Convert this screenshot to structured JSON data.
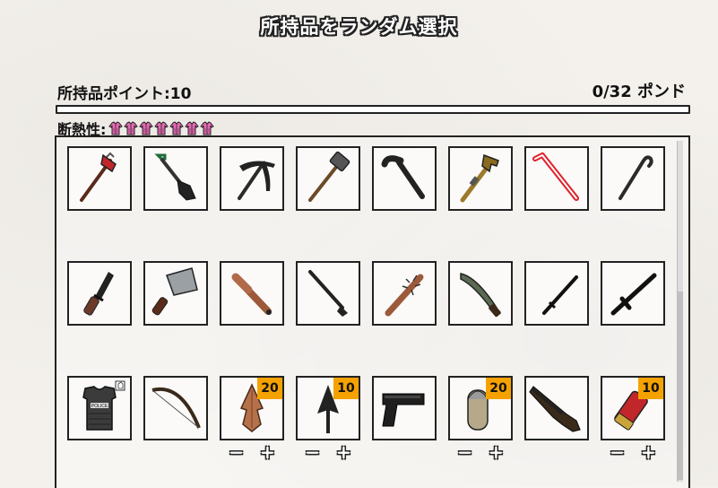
{
  "header": {
    "title": "所持品をランダム選択"
  },
  "stats": {
    "points_label": "所持品ポイント:10",
    "pounds_label": "0/32 ポンド",
    "weight_fraction": 0,
    "insulation_label": "断熱性:",
    "insulation_icons": 7
  },
  "colors": {
    "badge": "#f5a200",
    "selected_outline": "#e0202a",
    "jacket": "#e56ab4"
  },
  "items": [
    {
      "name": "斧",
      "icon": "axe-icon",
      "selected": false
    },
    {
      "name": "シャベル",
      "icon": "shovel-icon",
      "selected": false
    },
    {
      "name": "ツルハシ",
      "icon": "pickaxe-icon",
      "selected": false
    },
    {
      "name": "スレッジハンマー",
      "icon": "sledgehammer-icon",
      "selected": false
    },
    {
      "name": "パイプ",
      "icon": "pipe-icon",
      "selected": false
    },
    {
      "name": "パイプレンチ",
      "icon": "pipe-wrench-icon",
      "selected": false
    },
    {
      "name": "バール",
      "icon": "crowbar-icon",
      "selected": true
    },
    {
      "name": "鉤付きバール",
      "icon": "hooked-crowbar-icon",
      "selected": false
    },
    {
      "name": "ナイフ",
      "icon": "knife-icon",
      "selected": false
    },
    {
      "name": "肉切り包丁",
      "icon": "cleaver-icon",
      "selected": false
    },
    {
      "name": "野球バット",
      "icon": "baseball-bat-icon",
      "selected": false
    },
    {
      "name": "ゴルフクラブ",
      "icon": "golf-club-icon",
      "selected": false
    },
    {
      "name": "釘バット",
      "icon": "nail-bat-icon",
      "selected": false
    },
    {
      "name": "マチェーテ",
      "icon": "machete-icon",
      "selected": false
    },
    {
      "name": "刀",
      "icon": "katana-icon",
      "selected": false
    },
    {
      "name": "警棒",
      "icon": "tonfa-icon",
      "selected": false
    },
    {
      "name": "防弾ベスト",
      "icon": "police-vest-icon",
      "selected": false,
      "vest_text": "POLICE"
    },
    {
      "name": "弓",
      "icon": "bow-icon",
      "selected": false
    },
    {
      "name": "矢",
      "icon": "arrowhead-icon",
      "selected": false,
      "count": "20",
      "stepper": true
    },
    {
      "name": "槍",
      "icon": "spearhead-icon",
      "selected": false,
      "count": "10",
      "stepper": true
    },
    {
      "name": "拳銃",
      "icon": "pistol-icon",
      "selected": false
    },
    {
      "name": "弾薬",
      "icon": "bullets-icon",
      "selected": false,
      "count": "20",
      "stepper": true
    },
    {
      "name": "ショットガン",
      "icon": "shotgun-icon",
      "selected": false
    },
    {
      "name": "散弾",
      "icon": "shotgun-shell-icon",
      "selected": false,
      "count": "10",
      "stepper": true
    }
  ],
  "stepper": {
    "minus": "−",
    "plus": "+"
  }
}
